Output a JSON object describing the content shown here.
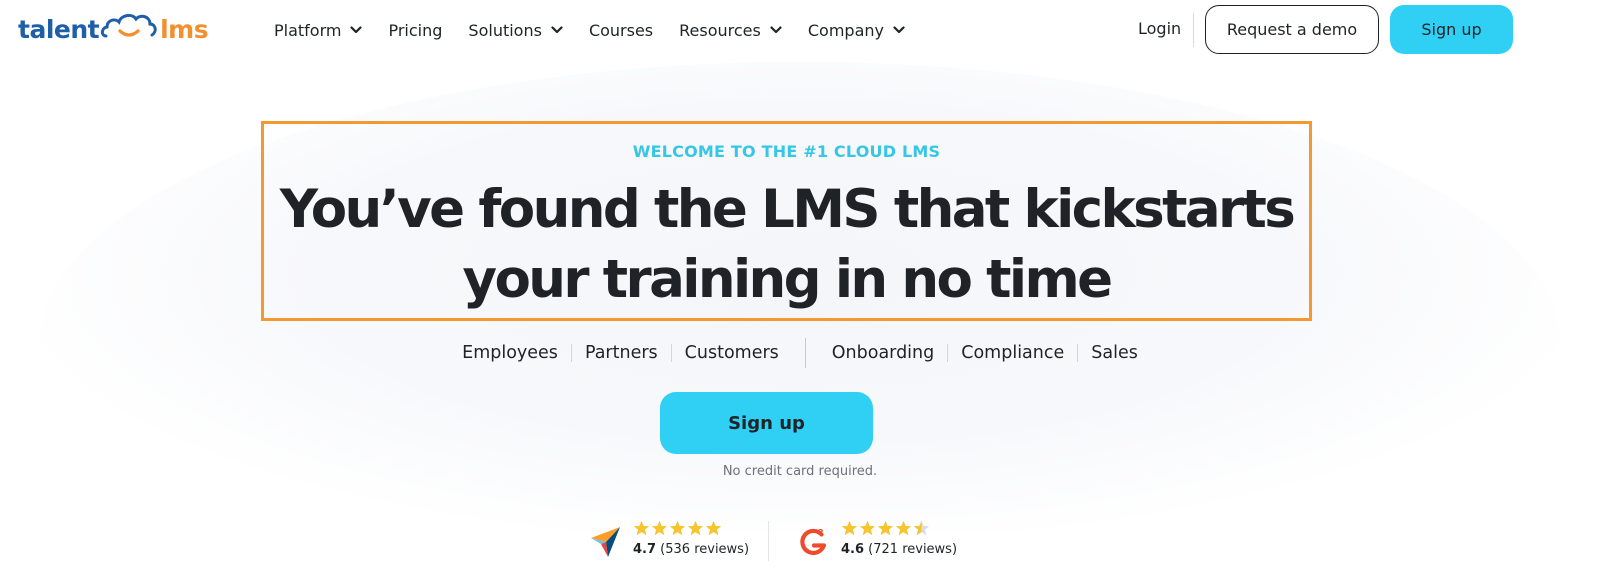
{
  "brand": {
    "logo_left": "talent",
    "logo_right": "lms",
    "colors": {
      "primary_blue": "#1e5fa8",
      "accent_orange": "#f2902f",
      "cta_cyan": "#2fd0f3",
      "eyebrow_cyan": "#36c6e6",
      "highlight_orange": "#f39a2e",
      "star_yellow": "#f5c431"
    }
  },
  "nav": {
    "items": [
      {
        "label": "Platform",
        "has_dropdown": true
      },
      {
        "label": "Pricing",
        "has_dropdown": false
      },
      {
        "label": "Solutions",
        "has_dropdown": true
      },
      {
        "label": "Courses",
        "has_dropdown": false
      },
      {
        "label": "Resources",
        "has_dropdown": true
      },
      {
        "label": "Company",
        "has_dropdown": true
      }
    ],
    "login": "Login",
    "demo": "Request a demo",
    "signup": "Sign up"
  },
  "hero": {
    "eyebrow": "WELCOME TO THE #1 CLOUD LMS",
    "headline_line1": "You’ve found the LMS that kickstarts",
    "headline_line2": "your training in no time",
    "audiences": [
      "Employees",
      "Partners",
      "Customers"
    ],
    "use_cases": [
      "Onboarding",
      "Compliance",
      "Sales"
    ],
    "cta": "Sign up",
    "cta_note": "No credit card required."
  },
  "ratings": [
    {
      "source_icon": "capterra-icon",
      "score": "4.7",
      "reviews": "(536 reviews)",
      "stars": 5
    },
    {
      "source_icon": "g2-icon",
      "score": "4.6",
      "reviews": "(721 reviews)",
      "stars": 4.5
    }
  ]
}
